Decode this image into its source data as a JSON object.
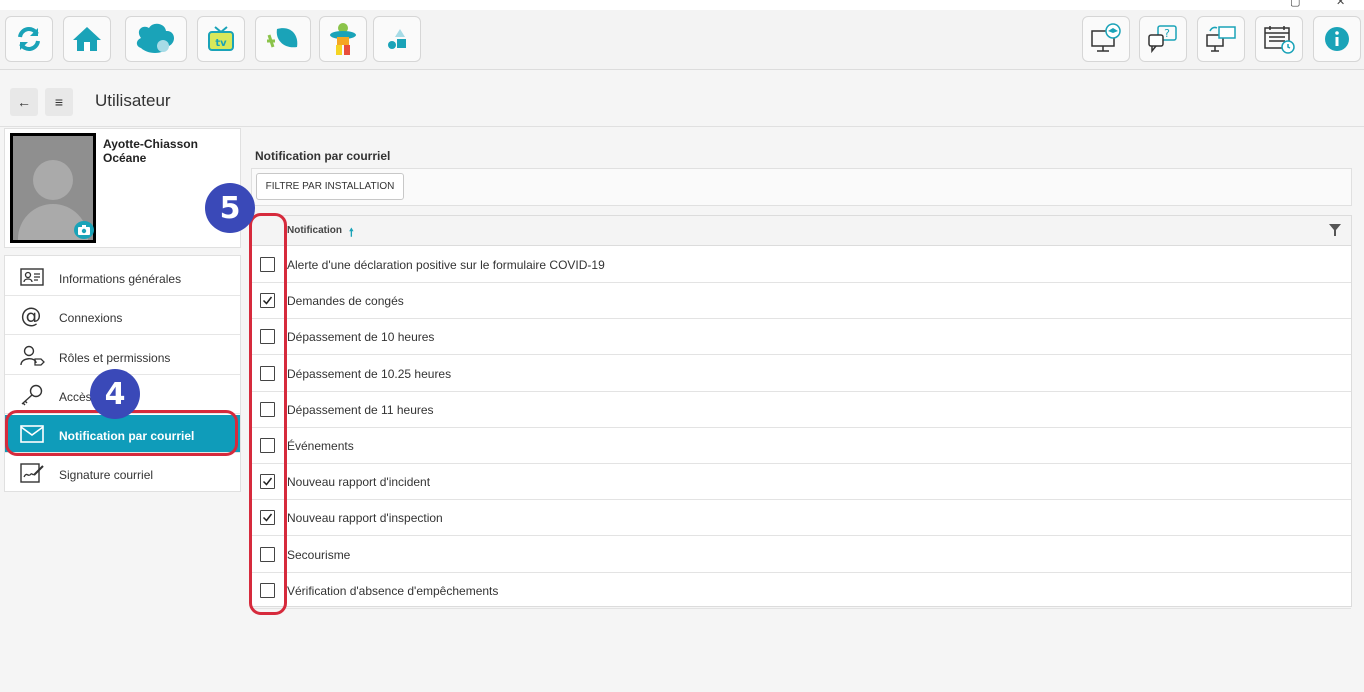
{
  "window": {
    "minimize": "—",
    "maximize": "▢",
    "close": "✕"
  },
  "toolbar": {
    "left_icons": [
      "refresh-icon",
      "home-icon",
      "heart-cloud-icon",
      "tv-icon",
      "leaf-drop-icon",
      "character-icon",
      "shapes-icon"
    ],
    "right_icons": [
      "computer-training-icon",
      "help-chat-icon",
      "sync-screens-icon",
      "calendar-clock-icon",
      "info-icon"
    ],
    "accent": "#1aa3b8"
  },
  "header": {
    "back": "←",
    "menu": "≡",
    "title": "Utilisateur"
  },
  "profile": {
    "name": "Ayotte-Chiasson Océane"
  },
  "menu": {
    "items": [
      {
        "label": "Informations générales",
        "icon": "id-card-icon"
      },
      {
        "label": "Connexions",
        "icon": "at-icon"
      },
      {
        "label": "Rôles et permissions",
        "icon": "user-tag-icon"
      },
      {
        "label": "Accès",
        "icon": "key-icon"
      },
      {
        "label": "Notification par courriel",
        "icon": "envelope-icon",
        "active": true
      },
      {
        "label": "Signature courriel",
        "icon": "signature-icon"
      }
    ]
  },
  "annotations": {
    "step4": "4",
    "step5": "5",
    "highlight_color": "#d62a3c",
    "badge_color": "#3a49b8"
  },
  "main": {
    "section_title": "Notification par courriel",
    "filter_button": "FILTRE PAR INSTALLATION",
    "column_header": "Notification",
    "sort_indicator": "🠕",
    "rows": [
      {
        "label": "Alerte d'une déclaration positive sur le formulaire COVID-19",
        "checked": false
      },
      {
        "label": "Demandes de congés",
        "checked": true
      },
      {
        "label": "Dépassement de 10 heures",
        "checked": false
      },
      {
        "label": "Dépassement de 10.25 heures",
        "checked": false
      },
      {
        "label": "Dépassement de 11 heures",
        "checked": false
      },
      {
        "label": "Événements",
        "checked": false
      },
      {
        "label": "Nouveau rapport d'incident",
        "checked": true
      },
      {
        "label": "Nouveau rapport d'inspection",
        "checked": true
      },
      {
        "label": "Secourisme",
        "checked": false
      },
      {
        "label": "Vérification d'absence d'empêchements",
        "checked": false
      }
    ]
  }
}
